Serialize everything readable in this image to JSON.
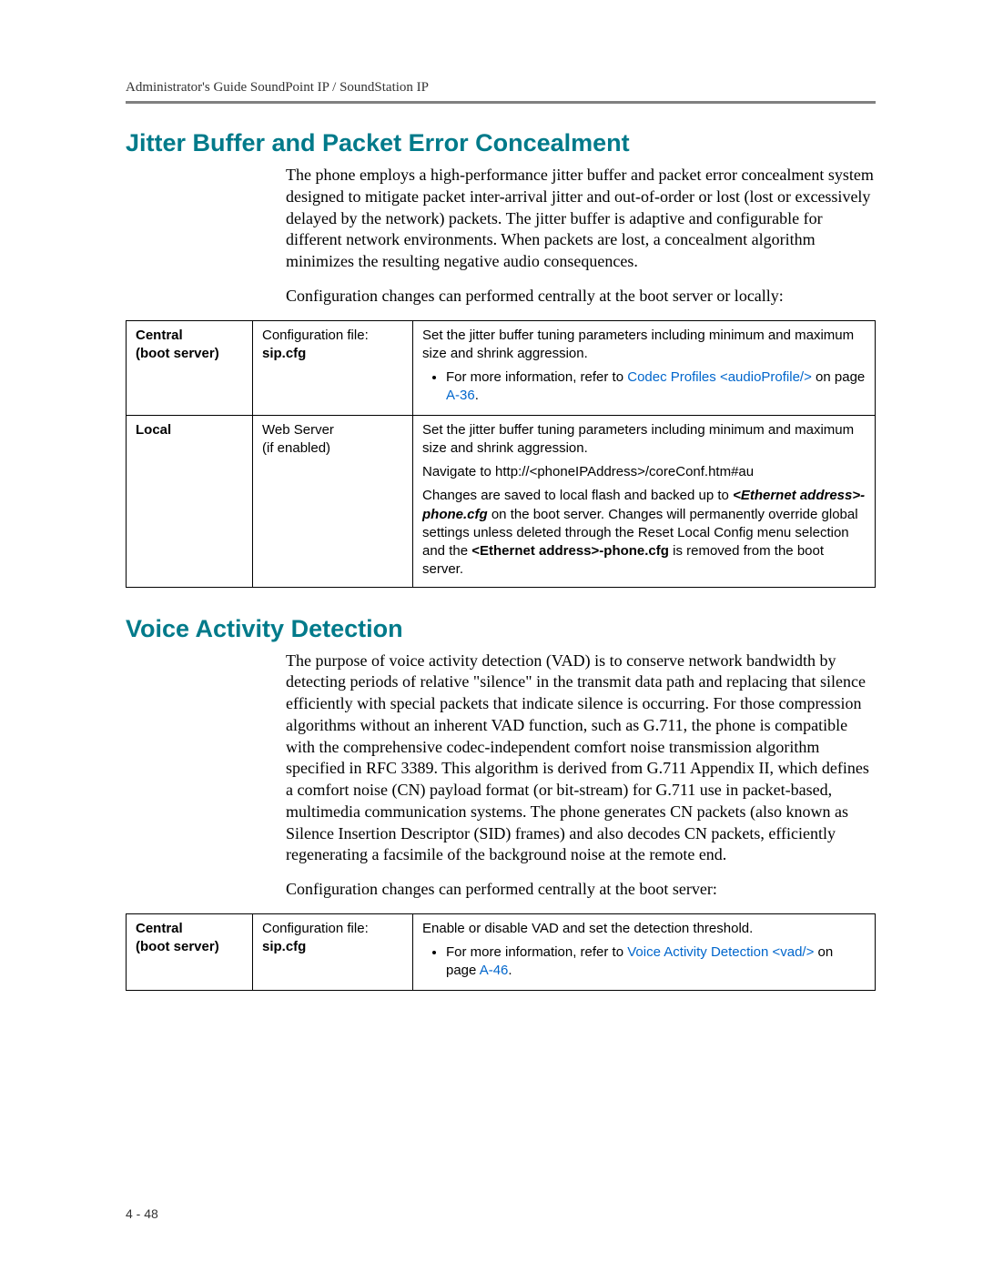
{
  "header": {
    "running": "Administrator's Guide SoundPoint IP / SoundStation IP"
  },
  "section1": {
    "title": "Jitter Buffer and Packet Error Concealment",
    "para1": "The phone employs a high-performance jitter buffer and packet error concealment system designed to mitigate packet inter-arrival jitter and out-of-order or lost (lost or excessively delayed by the network) packets. The jitter buffer is adaptive and configurable for different network environments. When packets are lost, a concealment algorithm minimizes the resulting negative audio consequences.",
    "para2": "Configuration changes can performed centrally at the boot server or locally:",
    "table": {
      "row1": {
        "col1a": "Central",
        "col1b": "(boot server)",
        "col2a": "Configuration file:",
        "col2b": "sip.cfg",
        "desc": "Set the jitter buffer tuning parameters including minimum and maximum size and shrink aggression.",
        "bullet_prefix": "For more information, refer to ",
        "bullet_link": "Codec Profiles <audioProfile/>",
        "bullet_mid": " on page ",
        "bullet_pagelink": "A-36",
        "bullet_end": "."
      },
      "row2": {
        "col1a": "Local",
        "col2a": "Web Server",
        "col2b": "(if enabled)",
        "desc1": "Set the jitter buffer tuning parameters including minimum and maximum size and shrink aggression.",
        "desc2": "Navigate to http://<phoneIPAddress>/coreConf.htm#au",
        "desc3a": "Changes are saved to local flash and backed up to ",
        "desc3b": "<Ethernet address>-phone.cfg",
        "desc3c": " on the boot server. Changes will permanently override global settings unless deleted through the Reset Local Config menu selection and the ",
        "desc3d": "<Ethernet address>-phone.cfg",
        "desc3e": " is removed from the boot server."
      }
    }
  },
  "section2": {
    "title": "Voice Activity Detection",
    "para1": "The purpose of voice activity detection (VAD) is to conserve network bandwidth by detecting periods of relative \"silence\" in the transmit data path and replacing that silence efficiently with special packets that indicate silence is occurring. For those compression algorithms without an inherent VAD function, such as G.711, the phone is compatible with the comprehensive codec-independent comfort noise transmission algorithm specified in RFC 3389. This algorithm is derived from G.711 Appendix II, which defines a comfort noise (CN) payload format (or bit-stream) for G.711 use in packet-based, multimedia communication systems. The phone generates CN packets (also known as Silence Insertion Descriptor (SID) frames) and also decodes CN packets, efficiently regenerating a facsimile of the background noise at the remote end.",
    "para2": "Configuration changes can performed centrally at the boot server:",
    "table": {
      "row1": {
        "col1a": "Central",
        "col1b": "(boot server)",
        "col2a": "Configuration file:",
        "col2b": "sip.cfg",
        "desc": "Enable or disable VAD and set the detection threshold.",
        "bullet_prefix": "For more information, refer to ",
        "bullet_link": "Voice Activity Detection <vad/>",
        "bullet_mid": " on page ",
        "bullet_pagelink": "A-46",
        "bullet_end": "."
      }
    }
  },
  "footer": {
    "pagenum": "4 - 48"
  }
}
